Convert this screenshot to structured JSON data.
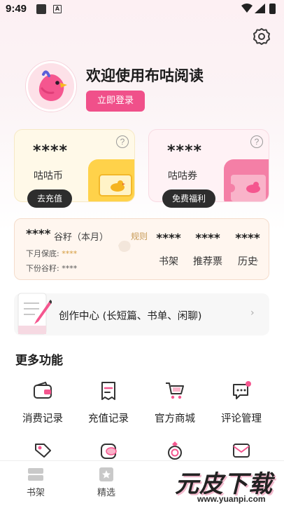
{
  "status_bar": {
    "time": "9:49",
    "notification_badge": "A"
  },
  "profile": {
    "welcome_text": "欢迎使用布咕阅读",
    "login_label": "立即登录"
  },
  "wallet": {
    "coin": {
      "value": "****",
      "label": "咕咕币",
      "button": "去充值"
    },
    "ticket": {
      "value": "****",
      "label": "咕咕券",
      "button": "免费福利"
    },
    "help_symbol": "?"
  },
  "grain": {
    "value": "****",
    "label": "谷籽（本月）",
    "rules": "规则",
    "next_guarantee_label": "下月保底:",
    "next_guarantee_value": "****",
    "next_grain_label": "下份谷籽:",
    "next_grain_value": "****"
  },
  "stats": [
    {
      "value": "****",
      "label": "书架"
    },
    {
      "value": "****",
      "label": "推荐票"
    },
    {
      "value": "****",
      "label": "历史"
    }
  ],
  "creation": {
    "label": "创作中心 (长短篇、书单、闲聊)"
  },
  "more_features": {
    "title": "更多功能",
    "items": [
      {
        "label": "消费记录",
        "icon": "wallet-icon"
      },
      {
        "label": "充值记录",
        "icon": "receipt-icon"
      },
      {
        "label": "官方商城",
        "icon": "cart-icon"
      },
      {
        "label": "评论管理",
        "icon": "comment-icon"
      }
    ],
    "row2_icons": [
      "tag-icon",
      "coins-icon",
      "ring-icon",
      "mail-icon"
    ]
  },
  "bottom_nav": [
    {
      "label": "书架",
      "icon": "bookshelf-icon"
    },
    {
      "label": "精选",
      "icon": "featured-icon"
    }
  ],
  "watermark": {
    "title": "元皮下载",
    "url": "www.yuanpi.com"
  },
  "colors": {
    "accent": "#f0508a",
    "coin_card": "#fff9e8",
    "ticket_card": "#fff2f5",
    "grain_panel": "#fff6ef",
    "rules_link": "#c79a56"
  }
}
